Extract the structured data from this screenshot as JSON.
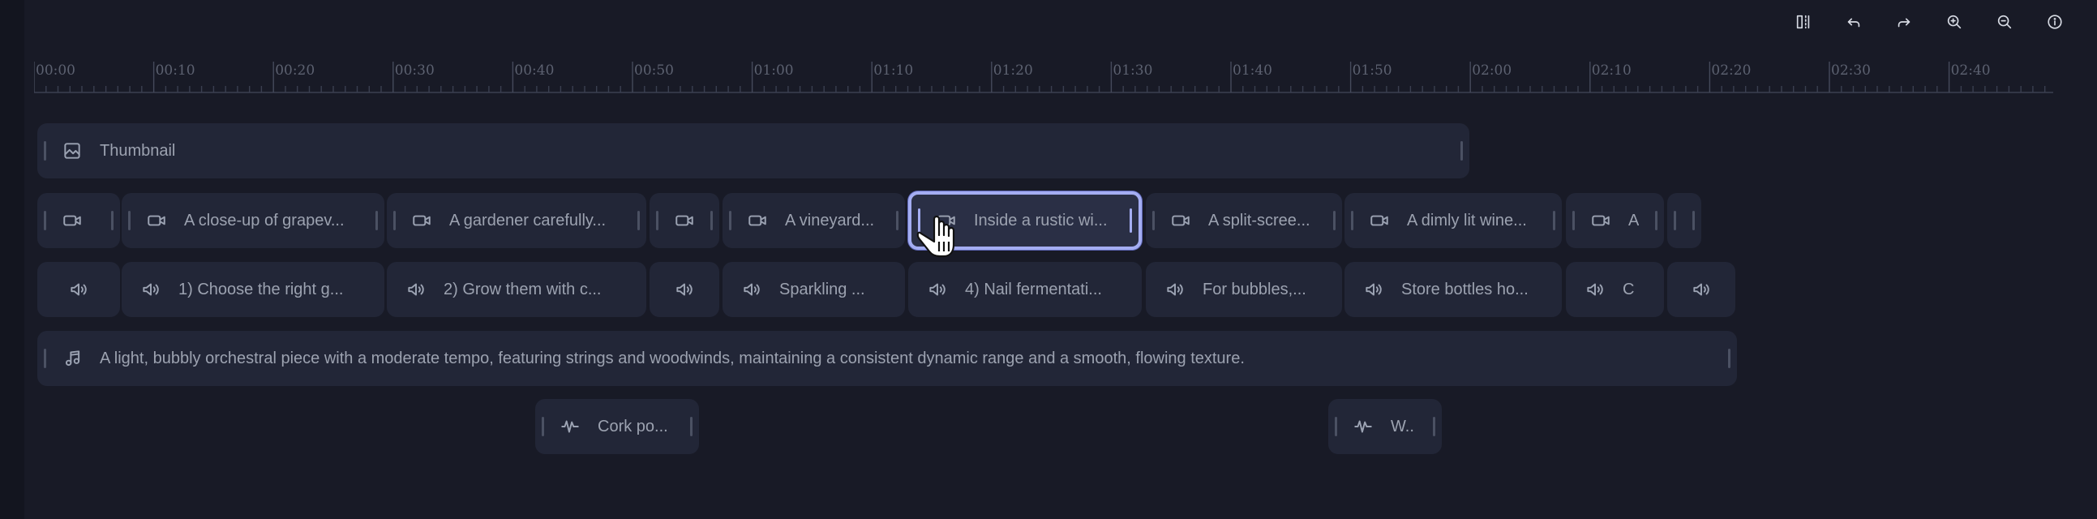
{
  "toolbar": {
    "buttons": [
      {
        "name": "split-view-button",
        "icon": "split-icon"
      },
      {
        "name": "undo-button",
        "icon": "undo-icon"
      },
      {
        "name": "redo-button",
        "icon": "redo-icon"
      },
      {
        "name": "zoom-in-button",
        "icon": "zoom-in-icon"
      },
      {
        "name": "zoom-out-button",
        "icon": "zoom-out-icon"
      },
      {
        "name": "info-button",
        "icon": "info-icon"
      }
    ]
  },
  "ruler": {
    "labels": [
      "00:00",
      "00:10",
      "00:20",
      "00:30",
      "00:40",
      "00:50",
      "01:00",
      "01:10",
      "01:20",
      "01:30",
      "01:40",
      "01:50",
      "02:00",
      "02:10",
      "02:20",
      "02:30",
      "02:40"
    ]
  },
  "tracks": {
    "thumbnail": {
      "label": "Thumbnail"
    },
    "video": [
      {
        "label": ""
      },
      {
        "label": "A close-up of grapev..."
      },
      {
        "label": "A gardener carefully..."
      },
      {
        "label": ""
      },
      {
        "label": "A vineyard..."
      },
      {
        "label": "Inside a rustic wi...",
        "selected": true
      },
      {
        "label": "A split-scree..."
      },
      {
        "label": "A dimly lit wine..."
      },
      {
        "label": "A"
      },
      {
        "label": ""
      }
    ],
    "voiceover": [
      {
        "label": ""
      },
      {
        "label": "1) Choose the right g..."
      },
      {
        "label": "2) Grow them with c..."
      },
      {
        "label": ""
      },
      {
        "label": "Sparkling ..."
      },
      {
        "label": "4) Nail fermentati..."
      },
      {
        "label": "For bubbles,..."
      },
      {
        "label": "Store bottles ho..."
      },
      {
        "label": "C"
      },
      {
        "label": ""
      }
    ],
    "music": {
      "label": "A light, bubbly orchestral piece with a moderate tempo, featuring strings and woodwinds, maintaining a consistent dynamic range and a smooth, flowing texture."
    },
    "sfx": [
      {
        "label": "Cork po..."
      },
      {
        "label": "W.."
      }
    ]
  },
  "colors": {
    "background": "#181a26",
    "clip": "#222637",
    "selected_border": "#a4adf2"
  }
}
